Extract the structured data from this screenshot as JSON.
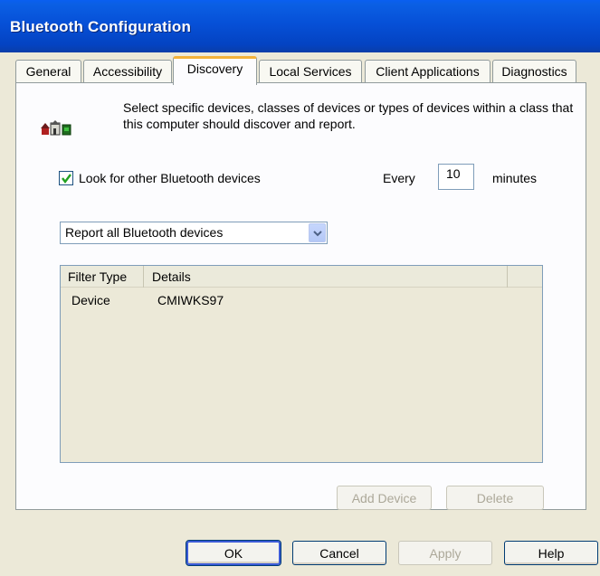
{
  "window": {
    "title": "Bluetooth Configuration"
  },
  "tabs": [
    {
      "label": "General",
      "active": false
    },
    {
      "label": "Accessibility",
      "active": false
    },
    {
      "label": "Discovery",
      "active": true
    },
    {
      "label": "Local Services",
      "active": false
    },
    {
      "label": "Client Applications",
      "active": false
    },
    {
      "label": "Diagnostics",
      "active": false
    }
  ],
  "discovery": {
    "description": "Select specific devices, classes of devices or types of devices within a class that this computer should discover and report.",
    "look_for_devices_label": "Look for other Bluetooth devices",
    "look_for_devices_checked": true,
    "every_label": "Every",
    "interval_value": "10",
    "minutes_label": "minutes",
    "report_select_value": "Report all Bluetooth devices",
    "filter_list": {
      "columns": [
        "Filter Type",
        "Details"
      ],
      "rows": [
        {
          "filter_type": "Device",
          "details": "CMIWKS97"
        }
      ]
    },
    "add_device_label": "Add Device",
    "delete_label": "Delete"
  },
  "footer": {
    "ok_label": "OK",
    "cancel_label": "Cancel",
    "apply_label": "Apply",
    "help_label": "Help"
  },
  "colors": {
    "titlebar": "#0650d7",
    "dialog_bg": "#ece9d8",
    "active_tab_accent": "#f2b23a",
    "checkmark": "#21a121",
    "disabled_text": "#aca899"
  }
}
